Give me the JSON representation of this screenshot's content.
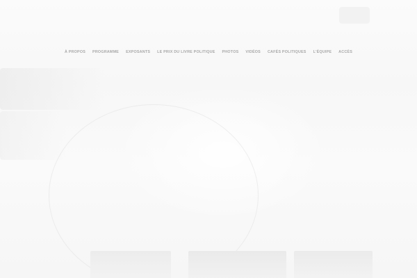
{
  "nav": {
    "items": [
      {
        "label": "À PROPOS"
      },
      {
        "label": "PROGRAMME"
      },
      {
        "label": "EXPOSANTS"
      },
      {
        "label": "LE PRIX DU LIVRE POLITIQUE"
      },
      {
        "label": "PHOTOS"
      },
      {
        "label": "VIDÉOS"
      },
      {
        "label": "CAFÉS POLITIQUES"
      },
      {
        "label": "L'ÉQUIPE"
      },
      {
        "label": "ACCÈS"
      }
    ]
  },
  "colors": {
    "background": "#fdfdfd",
    "nav_text": "#a8a8a8"
  }
}
